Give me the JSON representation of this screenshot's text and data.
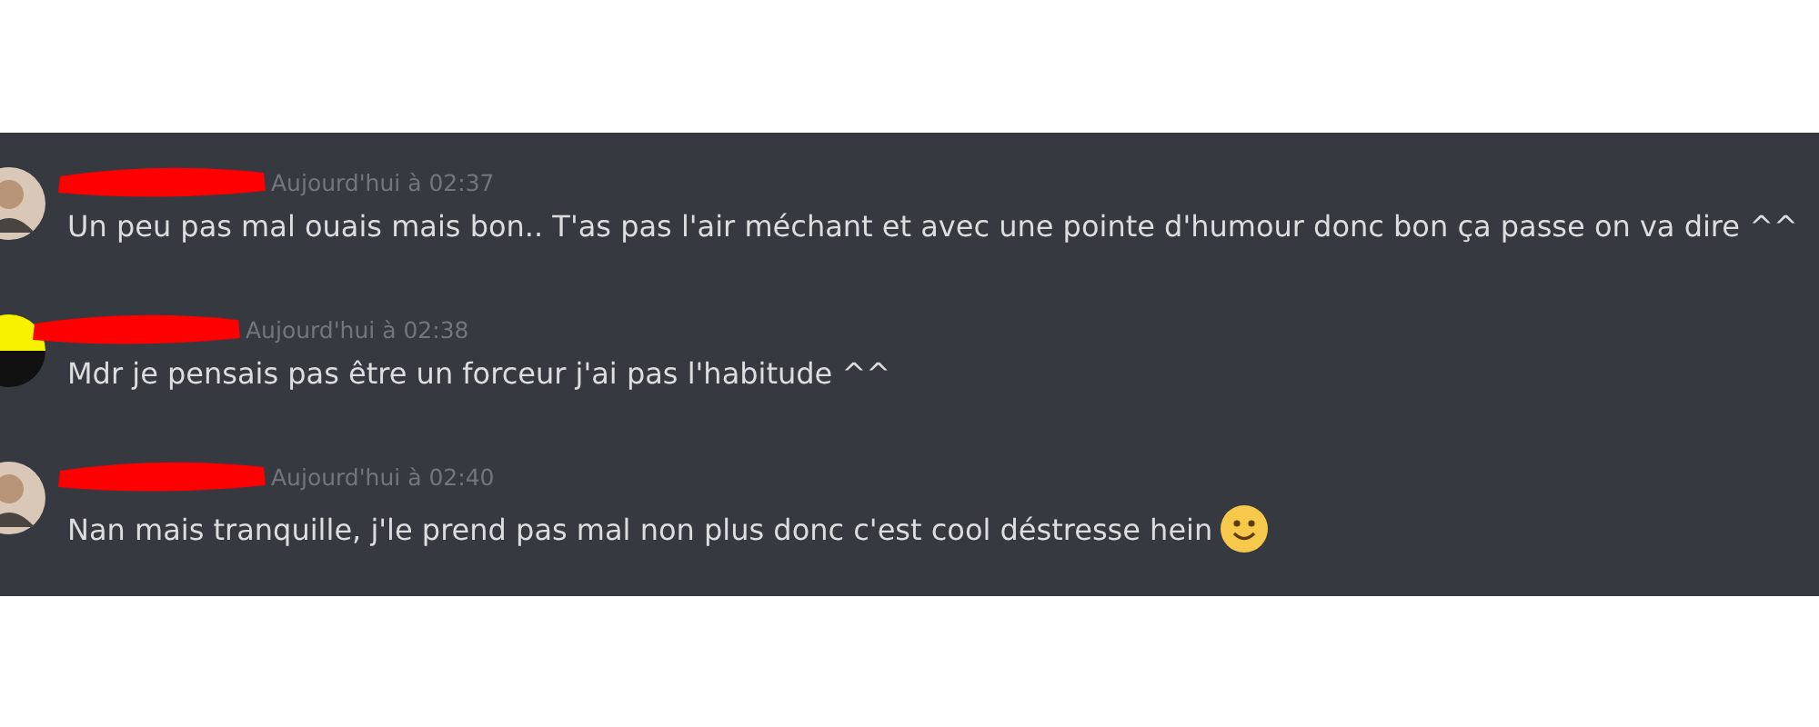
{
  "messages": [
    {
      "kind": "photo",
      "name_redacted": true,
      "timestamp": "Aujourd'hui à 02:37",
      "text": "Un peu pas mal ouais mais bon.. T'as pas l'air méchant et avec une pointe d'humour donc bon ça passe on va dire ^^"
    },
    {
      "kind": "split",
      "name_redacted": true,
      "timestamp": "Aujourd'hui à 02:38",
      "text": "Mdr je pensais pas être un forceur j'ai pas l'habitude ^^"
    },
    {
      "kind": "photo",
      "name_redacted": true,
      "timestamp": "Aujourd'hui à 02:40",
      "text": "Nan mais tranquille, j'le prend pas mal non plus donc c'est cool déstresse hein",
      "emoji": true
    }
  ]
}
